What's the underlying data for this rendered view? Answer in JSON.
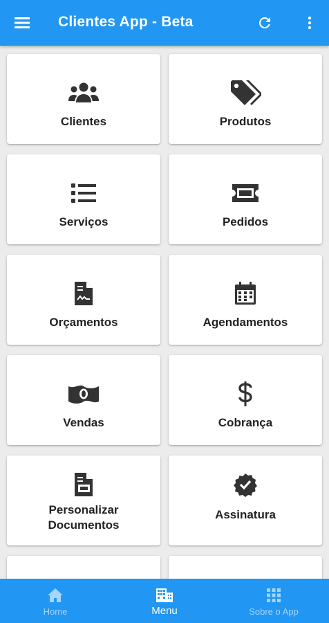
{
  "app": {
    "title": "Clientes App - Beta"
  },
  "icons": {
    "menu": "hamburger-menu-icon",
    "refresh": "refresh-icon",
    "more": "more-vertical-icon"
  },
  "colors": {
    "primary": "#2196f3",
    "card": "#ffffff",
    "icon": "#333333",
    "nav_inactive": "#a7d5fb"
  },
  "menu_items": [
    {
      "label": "Clientes",
      "icon": "users-icon"
    },
    {
      "label": "Produtos",
      "icon": "tags-icon"
    },
    {
      "label": "Serviços",
      "icon": "list-icon"
    },
    {
      "label": "Pedidos",
      "icon": "ticket-icon"
    },
    {
      "label": "Orçamentos",
      "icon": "invoice-file-icon"
    },
    {
      "label": "Agendamentos",
      "icon": "calendar-icon"
    },
    {
      "label": "Vendas",
      "icon": "money-bill-icon"
    },
    {
      "label": "Cobrança",
      "icon": "dollar-sign-icon"
    },
    {
      "label_line1": "Personalizar",
      "label_line2": "Documentos",
      "icon": "document-icon"
    },
    {
      "label": "Assinatura",
      "icon": "certificate-check-icon"
    }
  ],
  "bottom_nav": [
    {
      "label": "Home",
      "icon": "home-icon",
      "active": false
    },
    {
      "label": "Menu",
      "icon": "building-grid-icon",
      "active": true
    },
    {
      "label": "Sobre o App",
      "icon": "apps-grid-icon",
      "active": false
    }
  ]
}
